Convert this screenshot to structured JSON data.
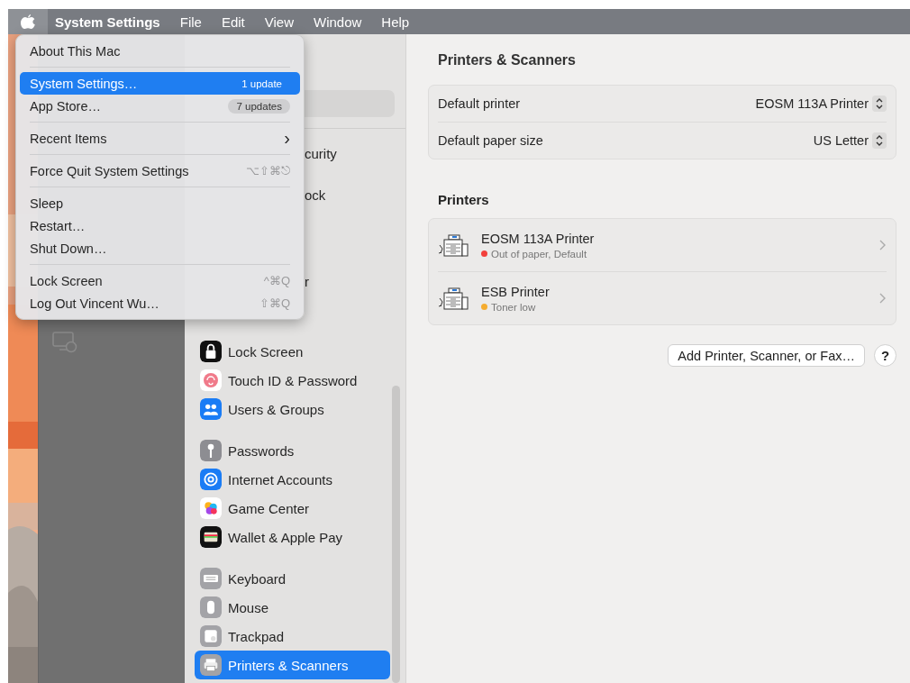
{
  "menubar": {
    "apple_selected": true,
    "items": [
      {
        "label": "System Settings",
        "kind": "app"
      },
      {
        "label": "File",
        "kind": "menu"
      },
      {
        "label": "Edit",
        "kind": "menu"
      },
      {
        "label": "View",
        "kind": "menu"
      },
      {
        "label": "Window",
        "kind": "menu"
      },
      {
        "label": "Help",
        "kind": "menu"
      }
    ]
  },
  "apple_menu": {
    "entries": [
      {
        "kind": "item",
        "label": "About This Mac",
        "selected": false
      },
      {
        "kind": "separator"
      },
      {
        "kind": "item",
        "label": "System Settings…",
        "badge": "1 update",
        "selected": true
      },
      {
        "kind": "item",
        "label": "App Store…",
        "badge": "7 updates",
        "selected": false
      },
      {
        "kind": "separator"
      },
      {
        "kind": "submenu",
        "label": "Recent Items",
        "arrow": "›",
        "selected": false
      },
      {
        "kind": "separator"
      },
      {
        "kind": "item",
        "label": "Force Quit System Settings",
        "shortcut": "⌥⇧⌘⎋",
        "selected": false
      },
      {
        "kind": "separator"
      },
      {
        "kind": "item",
        "label": "Sleep",
        "selected": false
      },
      {
        "kind": "item",
        "label": "Restart…",
        "selected": false
      },
      {
        "kind": "item",
        "label": "Shut Down…",
        "selected": false
      },
      {
        "kind": "separator"
      },
      {
        "kind": "item",
        "label": "Lock Screen",
        "shortcut": "^⌘Q",
        "selected": false
      },
      {
        "kind": "item",
        "label": "Log Out Vincent Wu…",
        "shortcut": "⇧⌘Q",
        "selected": false
      }
    ]
  },
  "sidebar": {
    "partial_rows": [
      "curity",
      "ock",
      "r"
    ],
    "groups": [
      {
        "items": [
          {
            "label": "Lock Screen",
            "selected": false
          },
          {
            "label": "Touch ID & Password",
            "selected": false
          },
          {
            "label": "Users & Groups",
            "selected": false
          }
        ]
      },
      {
        "items": [
          {
            "label": "Passwords",
            "selected": false
          },
          {
            "label": "Internet Accounts",
            "selected": false
          },
          {
            "label": "Game Center",
            "selected": false
          },
          {
            "label": "Wallet & Apple Pay",
            "selected": false
          }
        ]
      },
      {
        "items": [
          {
            "label": "Keyboard",
            "selected": false
          },
          {
            "label": "Mouse",
            "selected": false
          },
          {
            "label": "Trackpad",
            "selected": false
          },
          {
            "label": "Printers & Scanners",
            "selected": true
          }
        ]
      }
    ]
  },
  "main": {
    "title": "Printers & Scanners",
    "settings": [
      {
        "label": "Default printer",
        "value": "EOSM 113A Printer"
      },
      {
        "label": "Default paper size",
        "value": "US Letter"
      }
    ],
    "printers_heading": "Printers",
    "printers": [
      {
        "name": "EOSM 113A Printer",
        "status": "Out of paper, Default",
        "color": "#f2403c"
      },
      {
        "name": "ESB Printer",
        "status": "Toner low",
        "color": "#f5ac2f"
      }
    ],
    "add_button": "Add Printer, Scanner, or Fax…",
    "help_button": "?"
  }
}
